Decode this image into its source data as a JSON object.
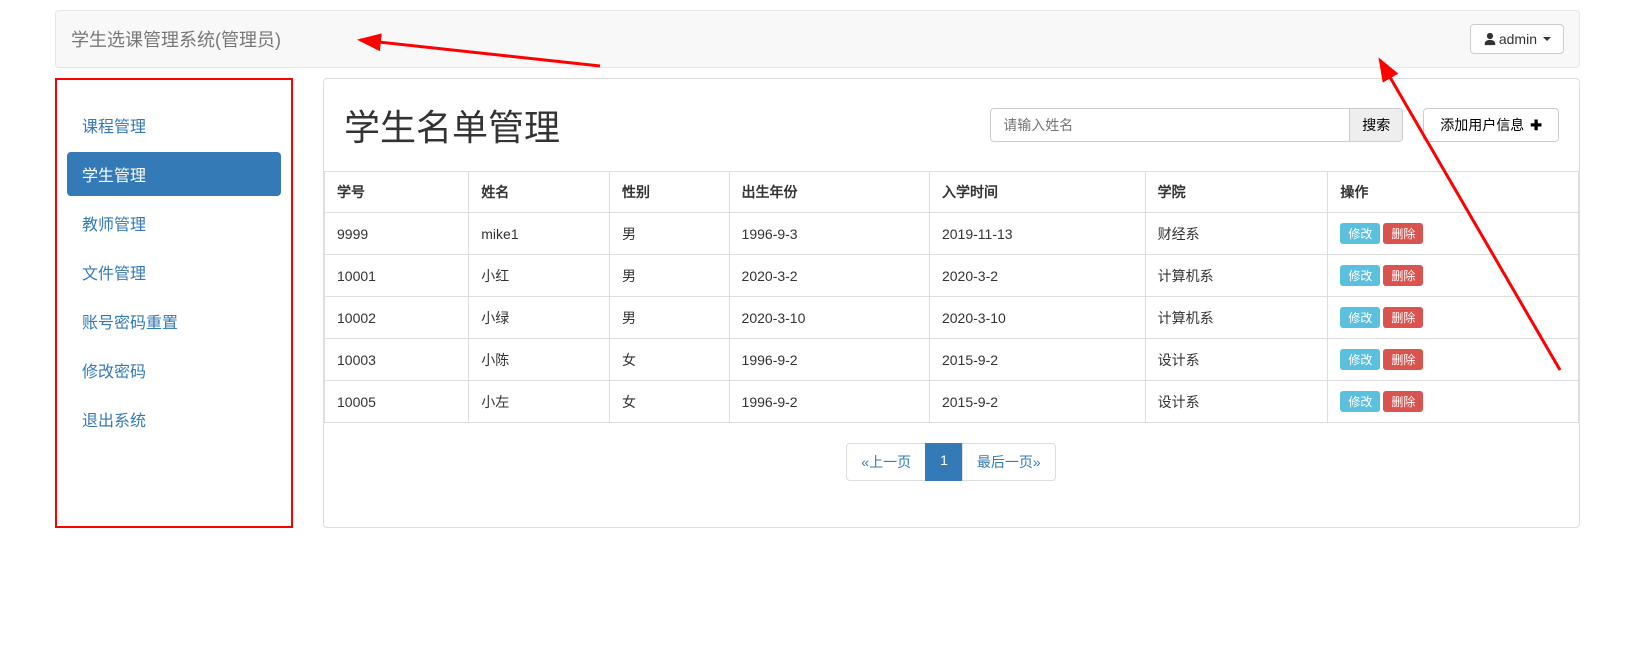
{
  "colors": {
    "primary": "#337ab7",
    "annotation": "#f00",
    "info_btn": "#5bc0de",
    "danger_btn": "#d9534f"
  },
  "navbar": {
    "brand": "学生选课管理系统(管理员)",
    "user_label": "admin"
  },
  "sidebar": {
    "items": [
      {
        "label": "课程管理",
        "active": false
      },
      {
        "label": "学生管理",
        "active": true
      },
      {
        "label": "教师管理",
        "active": false
      },
      {
        "label": "文件管理",
        "active": false
      },
      {
        "label": "账号密码重置",
        "active": false
      },
      {
        "label": "修改密码",
        "active": false
      },
      {
        "label": "退出系统",
        "active": false
      }
    ]
  },
  "main": {
    "title": "学生名单管理",
    "search": {
      "placeholder": "请输入姓名",
      "button": "搜索"
    },
    "add_button": "添加用户信息",
    "table": {
      "headers": [
        "学号",
        "姓名",
        "性别",
        "出生年份",
        "入学时间",
        "学院",
        "操作"
      ],
      "rows": [
        {
          "id": "9999",
          "name": "mike1",
          "gender": "男",
          "birth": "1996-9-3",
          "enroll": "2019-11-13",
          "college": "财经系"
        },
        {
          "id": "10001",
          "name": "小红",
          "gender": "男",
          "birth": "2020-3-2",
          "enroll": "2020-3-2",
          "college": "计算机系"
        },
        {
          "id": "10002",
          "name": "小绿",
          "gender": "男",
          "birth": "2020-3-10",
          "enroll": "2020-3-10",
          "college": "计算机系"
        },
        {
          "id": "10003",
          "name": "小陈",
          "gender": "女",
          "birth": "1996-9-2",
          "enroll": "2015-9-2",
          "college": "设计系"
        },
        {
          "id": "10005",
          "name": "小左",
          "gender": "女",
          "birth": "1996-9-2",
          "enroll": "2015-9-2",
          "college": "设计系"
        }
      ],
      "action_edit": "修改",
      "action_delete": "删除"
    },
    "pagination": {
      "prev": "«上一页",
      "current": "1",
      "last": "最后一页»"
    }
  }
}
